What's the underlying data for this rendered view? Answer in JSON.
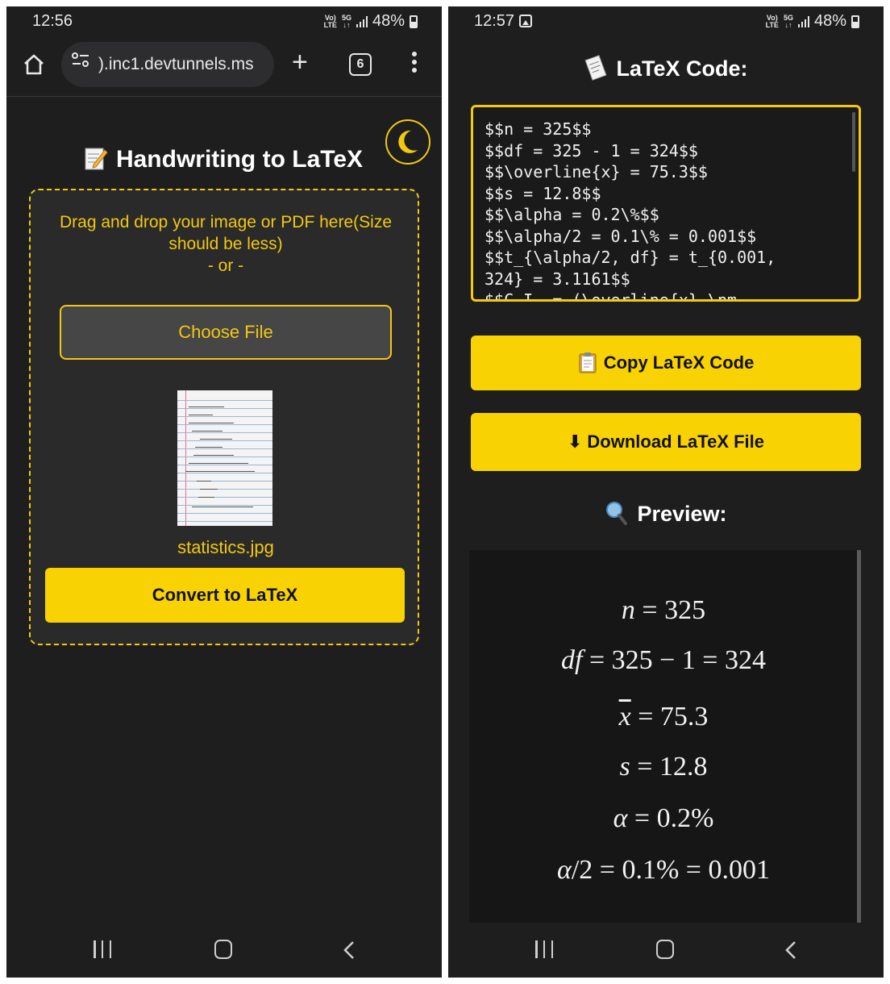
{
  "colors": {
    "accent": "#f8d203",
    "background": "#1e1e1e",
    "panel": "#2a2a2a"
  },
  "left": {
    "status": {
      "time": "12:56",
      "net_top": "Vo)",
      "net_bottom": "LTE",
      "net_type": "5G",
      "battery": "48%"
    },
    "browser": {
      "url": ").inc1.devtunnels.ms",
      "tab_count": "6"
    },
    "theme_toggle_icon": "moon-icon",
    "title": "Handwriting to LaTeX",
    "drop_text": "Drag and drop your image or PDF here(Size should be less)",
    "or_text": "- or -",
    "choose_file": "Choose File",
    "file_name": "statistics.jpg",
    "convert": "Convert to LaTeX"
  },
  "right": {
    "status": {
      "time": "12:57",
      "net_top": "Vo)",
      "net_bottom": "LTE",
      "net_type": "5G",
      "battery": "48%"
    },
    "latex_title": "LaTeX Code:",
    "latex_code": "$$n = 325$$\n$$df = 325 - 1 = 324$$\n$$\\overline{x} = 75.3$$\n$$s = 12.8$$\n$$\\alpha = 0.2\\%$$\n$$\\alpha/2 = 0.1\\% = 0.001$$\n$$t_{\\alpha/2, df} = t_{0.001,\n324} = 3.1161$$\n$$C.I. = (\\overline{x} \\pm",
    "copy_button": "Copy LaTeX Code",
    "download_button": "Download LaTeX File",
    "preview_title": "Preview:",
    "preview": {
      "n": {
        "var": "n",
        "rest": " = 325"
      },
      "df": {
        "var": "df",
        "rest": " = 325 − 1 = 324"
      },
      "xbar": {
        "var": "x",
        "rest": " = 75.3"
      },
      "s": {
        "var": "s",
        "rest": " = 12.8"
      },
      "alpha": {
        "var": "α",
        "rest": " = 0.2%"
      },
      "alpha_half": {
        "var": "α",
        "rest": "/2 = 0.1% = 0.001"
      }
    }
  }
}
